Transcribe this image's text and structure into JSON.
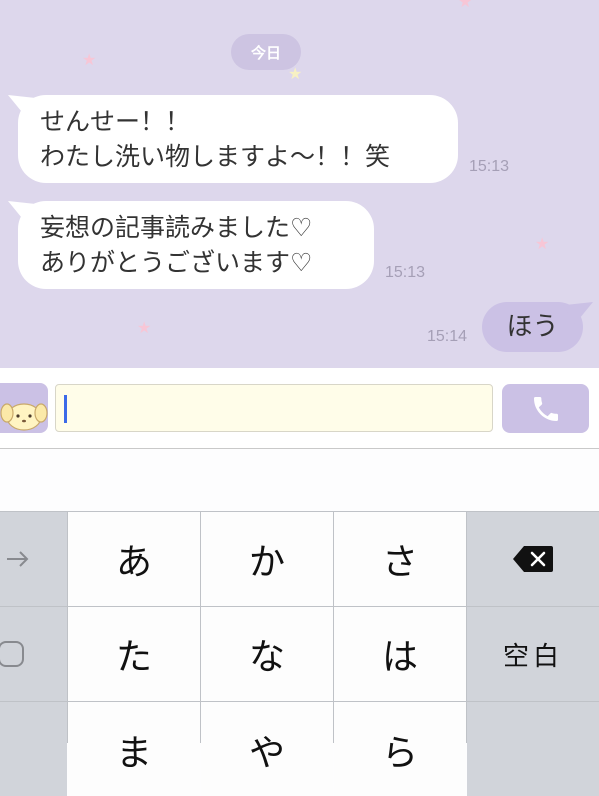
{
  "chat": {
    "date_label": "今日",
    "messages": [
      {
        "direction": "in",
        "lines": [
          "せんせー！！",
          "わたし洗い物しますよ〜！！笑"
        ],
        "time": "15:13"
      },
      {
        "direction": "in",
        "lines": [
          "妄想の記事読みました♡",
          "ありがとうございます♡"
        ],
        "time": "15:13"
      },
      {
        "direction": "out",
        "lines": [
          "ほう"
        ],
        "time": "15:14"
      }
    ]
  },
  "input": {
    "value": "",
    "avatar_icon": "dog-mascot-icon",
    "call_icon": "phone-icon"
  },
  "keyboard": {
    "row1": {
      "left_icon": "arrow-right-icon",
      "keys": [
        "あ",
        "か",
        "さ"
      ],
      "right_icon": "delete-icon"
    },
    "row2": {
      "left_icon": "undo-icon",
      "keys": [
        "た",
        "な",
        "は"
      ],
      "right_label": "空白"
    },
    "row3": {
      "keys": [
        "ま",
        "や",
        "ら"
      ]
    }
  },
  "colors": {
    "chat_background": "#ddd7ec",
    "outgoing_bubble": "#cbc1e5",
    "incoming_bubble": "#ffffff",
    "input_background": "#fffde9",
    "caret": "#3c6ae8"
  }
}
